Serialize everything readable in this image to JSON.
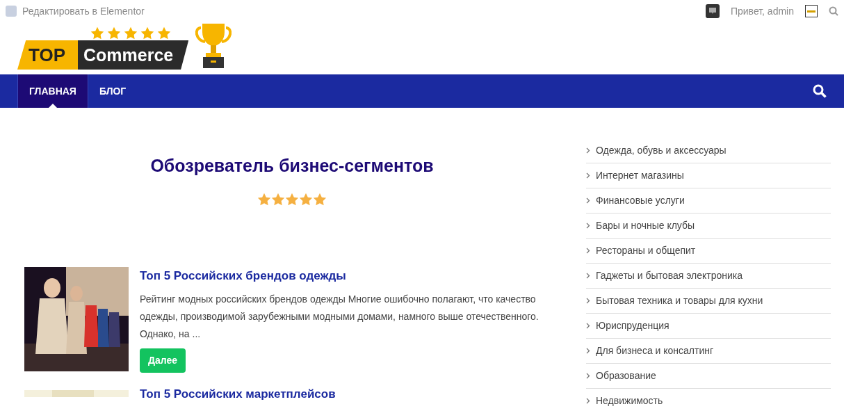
{
  "admin_bar": {
    "edit_link": "Редактировать в Elementor",
    "greeting": "Привет, admin"
  },
  "logo": {
    "word_1": "TOP",
    "word_2": "Commerce",
    "stars": 5
  },
  "nav": {
    "items": [
      {
        "label": "ГЛАВНАЯ",
        "selected": true
      },
      {
        "label": "БЛОГ",
        "selected": false
      }
    ]
  },
  "hero": {
    "title": "Обозреватель бизнес-сегментов",
    "stars": 5
  },
  "posts": [
    {
      "title": "Топ 5 Российских брендов одежды",
      "excerpt": "Рейтинг модных российских брендов одежды Многие ошибочно полагают, что качество одежды, производимой зарубежными модными домами, намного выше отечественного. Однако, на ...",
      "button": "Далее"
    },
    {
      "title": "Топ 5 Российских маркетплейсов"
    }
  ],
  "sidebar": {
    "items": [
      "Одежда, обувь и аксессуары",
      "Интернет магазины",
      "Финансовые услуги",
      "Бары и ночные клубы",
      "Рестораны и общепит",
      "Гаджеты и бытовая электроника",
      "Бытовая техника и товары для кухни",
      "Юриспруденция",
      "Для бизнеса и консалтинг",
      "Образование",
      "Недвижимость"
    ]
  }
}
